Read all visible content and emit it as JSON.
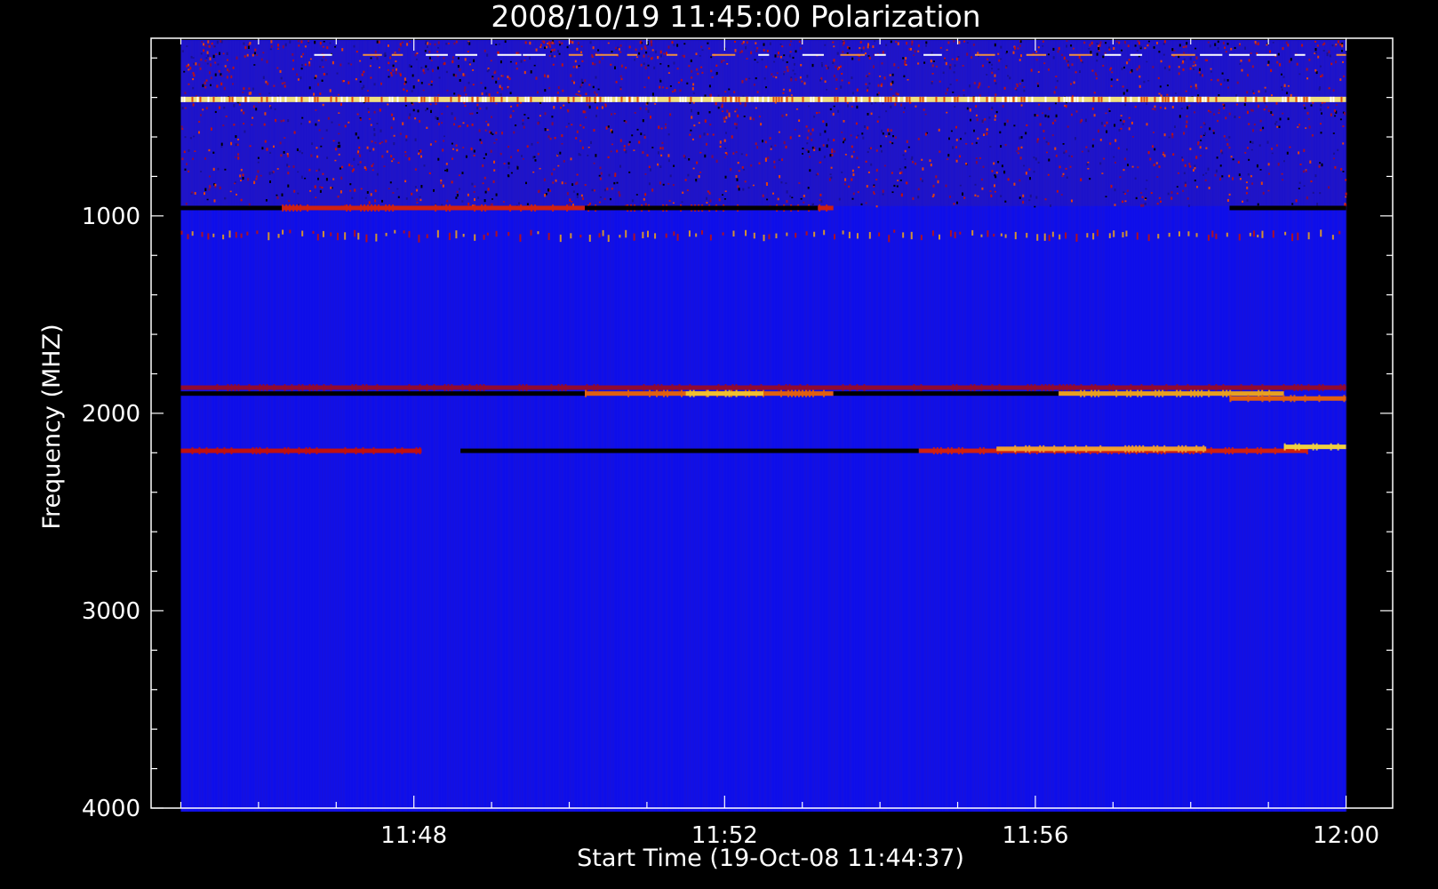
{
  "chart_data": {
    "type": "heatmap",
    "title": "2008/10/19 11:45:00 Polarization",
    "xlabel": "Start Time (19-Oct-08 11:44:37)",
    "ylabel": "Frequency (MHZ)",
    "x_ticks": [
      "11:48",
      "11:52",
      "11:56",
      "12:00"
    ],
    "x_tick_minutes": [
      48,
      52,
      56,
      60
    ],
    "xlim_minutes": [
      44.617,
      60.6
    ],
    "data_x_range_minutes": [
      45,
      60
    ],
    "y_ticks": [
      1000,
      2000,
      3000,
      4000
    ],
    "ylim": [
      100,
      4000
    ],
    "y_reversed": true,
    "grid": false,
    "colors": {
      "background": "#000000",
      "low": "#1010e8",
      "mid": "#c01010",
      "high": "#ffff60",
      "zero": "#000000"
    },
    "features": [
      {
        "kind": "noisy_band",
        "f_start": 110,
        "f_end": 950
      },
      {
        "kind": "bright_line",
        "freq": 410,
        "t_start": 45,
        "t_end": 60,
        "color": "#f0e080"
      },
      {
        "kind": "line",
        "freq": 960,
        "t_start": 46.3,
        "t_end": 53.4,
        "color": "#d02010"
      },
      {
        "kind": "line",
        "freq": 960,
        "t_start": 45,
        "t_end": 46.3,
        "color": "#000000"
      },
      {
        "kind": "line",
        "freq": 960,
        "t_start": 50.2,
        "t_end": 53.2,
        "color": "#000000"
      },
      {
        "kind": "line",
        "freq": 960,
        "t_start": 58.5,
        "t_end": 60,
        "color": "#000000"
      },
      {
        "kind": "dashes",
        "freq": 1110,
        "t_start": 45,
        "t_end": 60
      },
      {
        "kind": "line",
        "freq": 1870,
        "t_start": 45,
        "t_end": 60,
        "color": "#900a30"
      },
      {
        "kind": "line",
        "freq": 1900,
        "t_start": 45,
        "t_end": 50.2,
        "color": "#000000"
      },
      {
        "kind": "line",
        "freq": 1900,
        "t_start": 50.2,
        "t_end": 53.4,
        "color": "#e06010"
      },
      {
        "kind": "line",
        "freq": 1900,
        "t_start": 51.5,
        "t_end": 52.5,
        "color": "#f0c030"
      },
      {
        "kind": "line",
        "freq": 1900,
        "t_start": 53.4,
        "t_end": 56.3,
        "color": "#000000"
      },
      {
        "kind": "line",
        "freq": 1900,
        "t_start": 56.3,
        "t_end": 59.2,
        "color": "#e8a020"
      },
      {
        "kind": "line",
        "freq": 1925,
        "t_start": 58.5,
        "t_end": 60,
        "color": "#e06010"
      },
      {
        "kind": "line",
        "freq": 2190,
        "t_start": 45,
        "t_end": 48.1,
        "color": "#c01010"
      },
      {
        "kind": "line",
        "freq": 2190,
        "t_start": 48.6,
        "t_end": 54.5,
        "color": "#000000"
      },
      {
        "kind": "line",
        "freq": 2190,
        "t_start": 54.5,
        "t_end": 59.5,
        "color": "#d02010"
      },
      {
        "kind": "line",
        "freq": 2180,
        "t_start": 55.5,
        "t_end": 58.2,
        "color": "#f0a030"
      },
      {
        "kind": "line",
        "freq": 2170,
        "t_start": 59.2,
        "t_end": 60,
        "color": "#f0d040"
      }
    ]
  }
}
